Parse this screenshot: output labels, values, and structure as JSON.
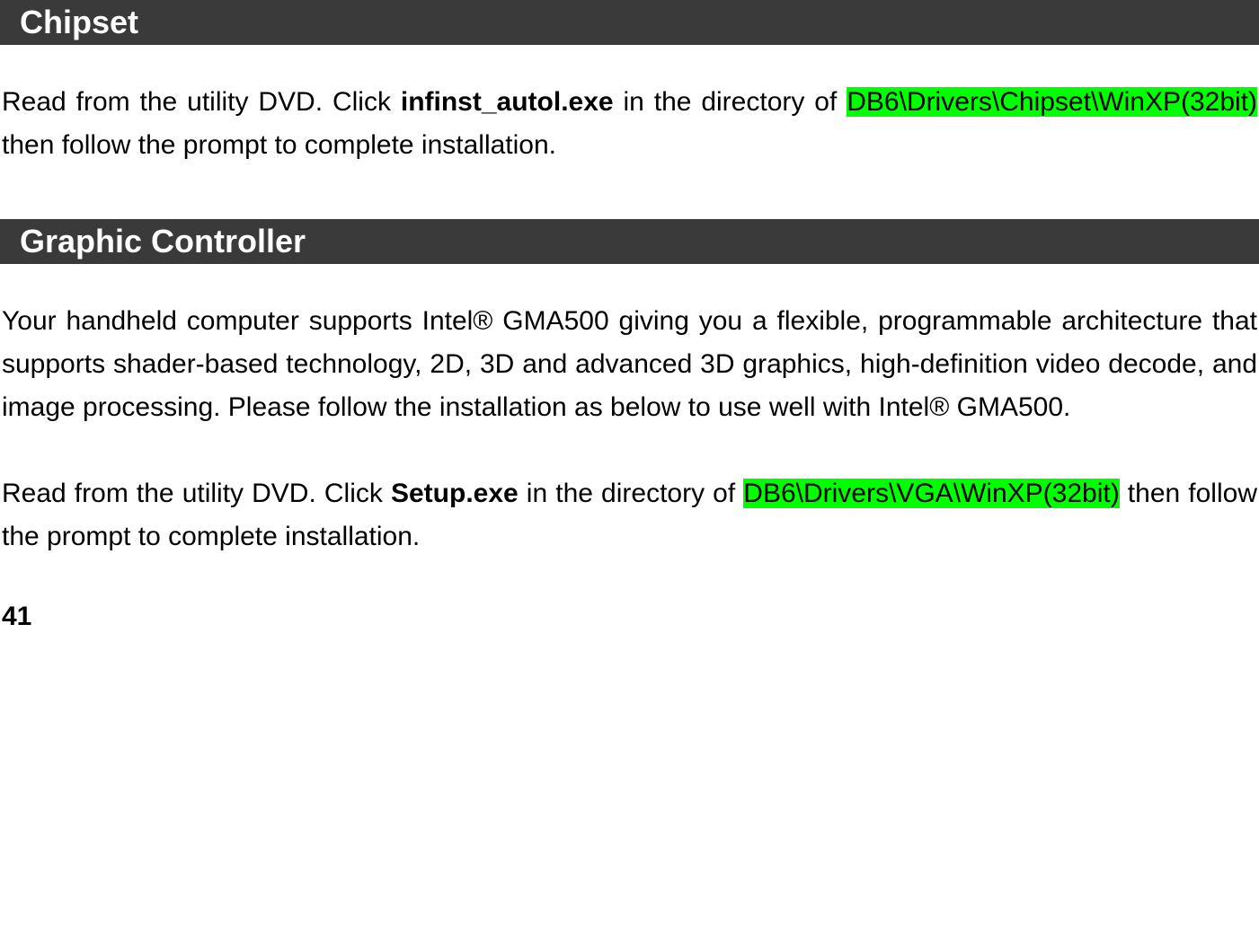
{
  "sections": {
    "chipset": {
      "title": "Chipset",
      "paragraph_prefix": "Read from the utility DVD. Click ",
      "executable": "infinst_autol.exe",
      "paragraph_mid": " in the directory of ",
      "path": "DB6\\Drivers\\Chipset\\WinXP(32bit)",
      "paragraph_suffix": " then follow the prompt to complete installation."
    },
    "graphic": {
      "title": "Graphic Controller",
      "intro": "Your handheld computer supports Intel® GMA500 giving you a flexible, programmable architecture that supports shader-based technology, 2D, 3D and advanced 3D graphics, high-definition video decode, and image processing. Please follow the installation as below to use well with Intel® GMA500.",
      "paragraph_prefix": "Read from the utility DVD. Click ",
      "executable": "Setup.exe",
      "paragraph_mid": " in the directory of ",
      "path": "DB6\\Drivers\\VGA\\WinXP(32bit)",
      "paragraph_suffix": " then follow the prompt to complete installation."
    }
  },
  "page_number": "41"
}
